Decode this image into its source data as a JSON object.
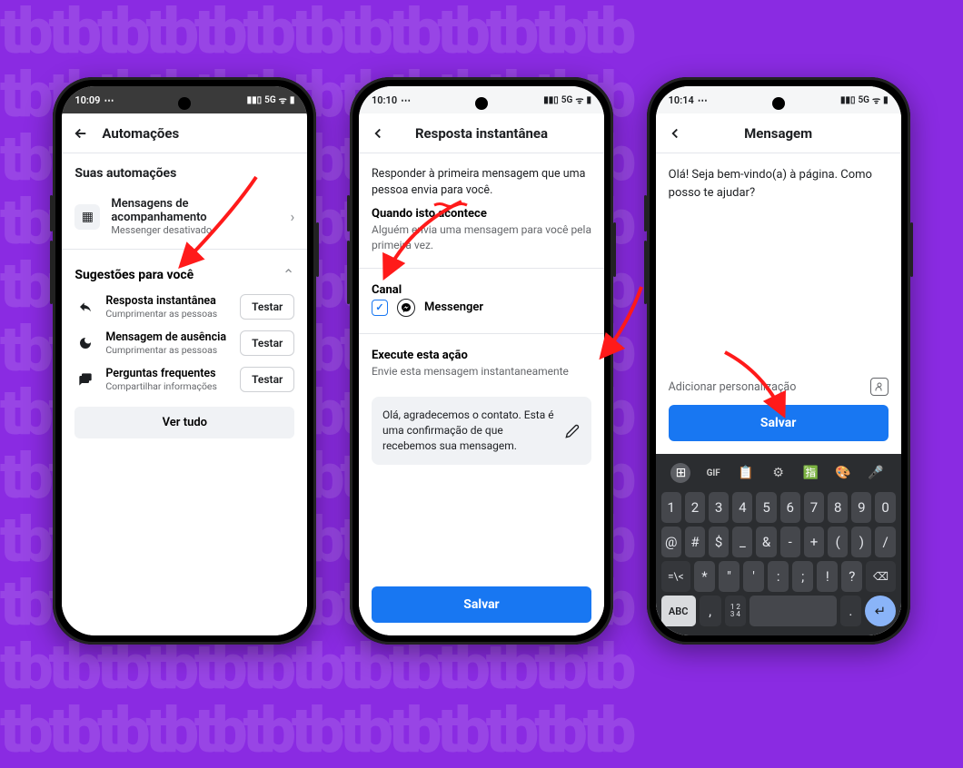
{
  "phone1": {
    "status": {
      "time": "10:09",
      "net": "5G"
    },
    "header": "Automações",
    "section_your": "Suas automações",
    "followup": {
      "title": "Mensagens de acompanhamento",
      "sub": "Messenger desativado"
    },
    "suggestions_header": "Sugestões para você",
    "sg": [
      {
        "title": "Resposta instantânea",
        "sub": "Cumprimentar as pessoas",
        "btn": "Testar"
      },
      {
        "title": "Mensagem de ausência",
        "sub": "Cumprimentar as pessoas",
        "btn": "Testar"
      },
      {
        "title": "Perguntas frequentes",
        "sub": "Compartilhar informações",
        "btn": "Testar"
      }
    ],
    "ver_tudo": "Ver tudo"
  },
  "phone2": {
    "status": {
      "time": "10:10",
      "net": "5G"
    },
    "header": "Resposta instantânea",
    "intro": "Responder à primeira mensagem que uma pessoa envia para você.",
    "when_h": "Quando isto acontece",
    "when_d": "Alguém envia uma mensagem para você pela primeira vez.",
    "channel_h": "Canal",
    "channel_name": "Messenger",
    "action_h": "Execute esta ação",
    "action_d": "Envie esta mensagem instantaneamente",
    "msg": "Olá, agradecemos o contato. Esta é uma confirmação de que recebemos sua mensagem.",
    "save": "Salvar"
  },
  "phone3": {
    "status": {
      "time": "10:14",
      "net": "5G"
    },
    "header": "Mensagem",
    "msg": "Olá! Seja bem-vindo(a) à página. Como posso te ajudar?",
    "personal": "Adicionar personalização",
    "save": "Salvar",
    "kb": {
      "top": [
        "grid",
        "GIF",
        "clip",
        "gear",
        "trans",
        "palette",
        "mic"
      ],
      "r1": [
        "1",
        "2",
        "3",
        "4",
        "5",
        "6",
        "7",
        "8",
        "9",
        "0"
      ],
      "r2": [
        "@",
        "#",
        "$",
        "_",
        "&",
        "-",
        "+",
        "(",
        ")",
        "/"
      ],
      "r3_left": "=\\<",
      "r3": [
        "*",
        "\"",
        "'",
        ":",
        ";",
        "!",
        "?"
      ],
      "r3_right": "⌫",
      "r4_abc": "ABC",
      "r4_comma": ",",
      "r4_num": "1 2\n3 4",
      "r4_period": ".",
      "r4_enter": "↵"
    }
  }
}
